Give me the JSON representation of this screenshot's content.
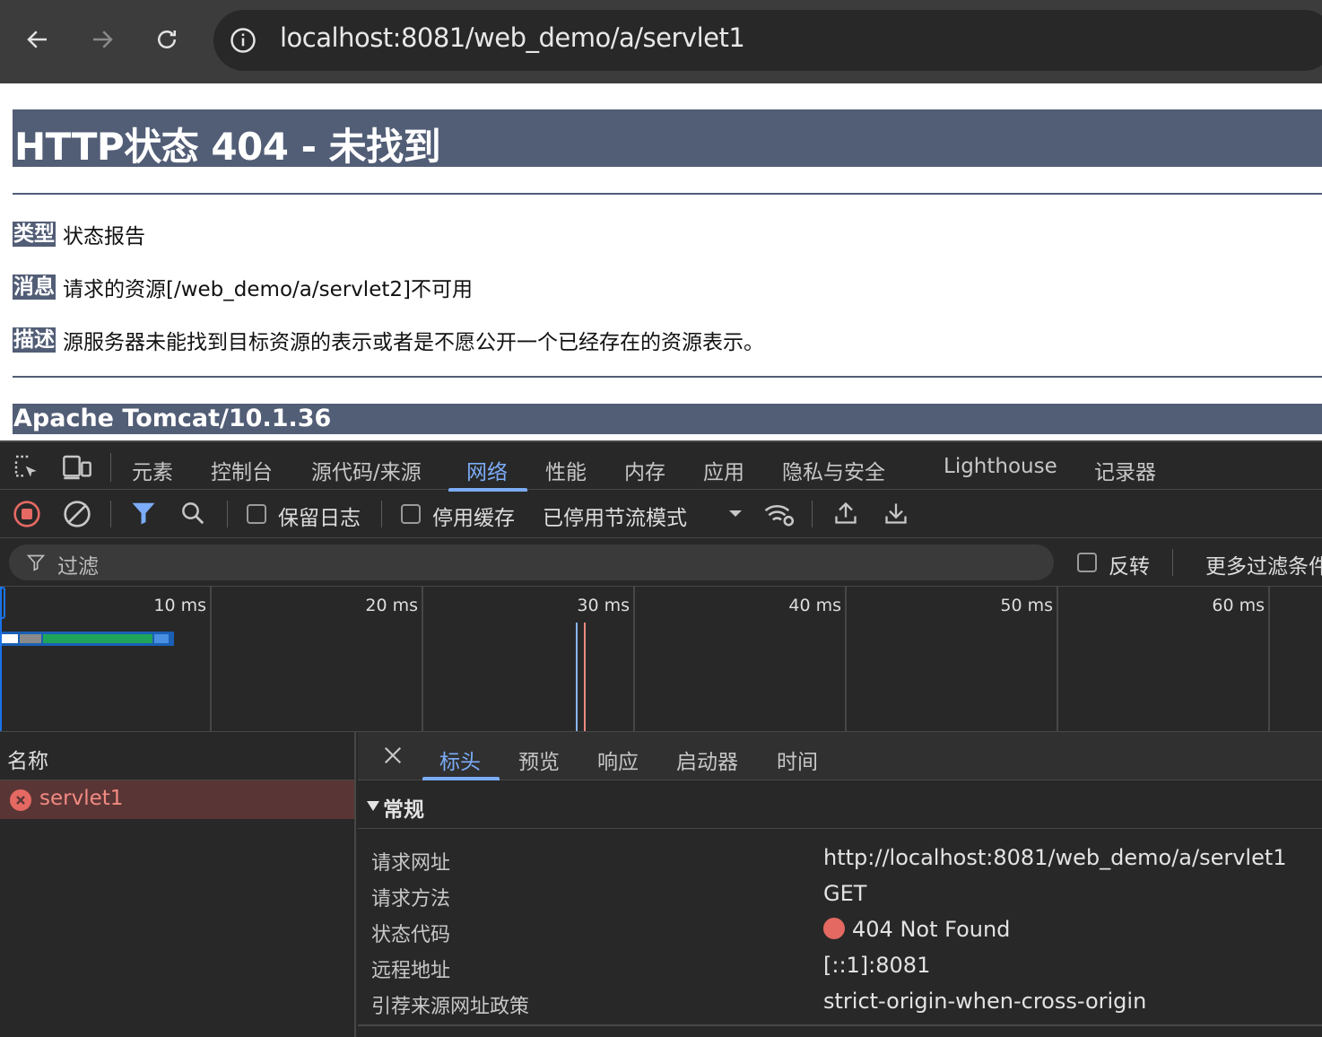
{
  "browser": {
    "url": "localhost:8081/web_demo/a/servlet1"
  },
  "page": {
    "title": "HTTP状态 404 - 未找到",
    "rows": [
      {
        "label": "类型",
        "text": "状态报告"
      },
      {
        "label": "消息",
        "text": "请求的资源[/web_demo/a/servlet2]不可用"
      },
      {
        "label": "描述",
        "text": "源服务器未能找到目标资源的表示或者是不愿公开一个已经存在的资源表示。"
      }
    ],
    "footer": "Apache Tomcat/10.1.36"
  },
  "devtools": {
    "tabs": [
      "元素",
      "控制台",
      "源代码/来源",
      "网络",
      "性能",
      "内存",
      "应用",
      "隐私与安全",
      "Lighthouse",
      "记录器"
    ],
    "active_tab": "网络",
    "toolbar": {
      "preserve_log": "保留日志",
      "disable_cache": "停用缓存",
      "throttling": "已停用节流模式"
    },
    "filter": {
      "placeholder": "过滤",
      "invert": "反转",
      "more_filters": "更多过滤条件"
    },
    "timeline": {
      "ticks": [
        "10 ms",
        "20 ms",
        "30 ms",
        "40 ms",
        "50 ms",
        "60 ms"
      ]
    },
    "requests": {
      "header": "名称",
      "items": [
        {
          "name": "servlet1",
          "status": "error"
        }
      ]
    },
    "detail": {
      "tabs": [
        "标头",
        "预览",
        "响应",
        "启动器",
        "时间"
      ],
      "active_tab": "标头",
      "section": "常规",
      "general": [
        {
          "key": "请求网址",
          "value": "http://localhost:8081/web_demo/a/servlet1"
        },
        {
          "key": "请求方法",
          "value": "GET"
        },
        {
          "key": "状态代码",
          "value": "404 Not Found"
        },
        {
          "key": "远程地址",
          "value": "[::1]:8081"
        },
        {
          "key": "引荐来源网址政策",
          "value": "strict-origin-when-cross-origin"
        }
      ]
    },
    "colors": {
      "accent": "#7cacf8",
      "error": "#e46962",
      "tomcat_bar": "#525d76"
    }
  }
}
